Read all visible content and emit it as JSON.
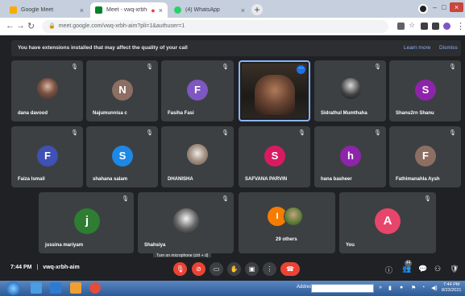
{
  "browser": {
    "tabs": [
      {
        "title": "Google Meet",
        "favicon_color": "#f9ab00",
        "active": false
      },
      {
        "title": "Meet - vwq-xrbh-aim",
        "favicon_color": "#00832d",
        "active": true
      },
      {
        "title": "(4) WhatsApp",
        "favicon_color": "#25d366",
        "active": false
      }
    ],
    "new_tab": "+",
    "url": "meet.google.com/vwq-xrbh-aim?pli=1&authuser=1"
  },
  "notice": {
    "text": "You have extensions installed that may affect the quality of your call",
    "learn_more": "Learn more",
    "dismiss": "Dismiss"
  },
  "participants": {
    "row1": [
      {
        "name": "dana davood",
        "kind": "photo"
      },
      {
        "name": "Najumunnisa c",
        "initial": "N",
        "color": "#8d6e63"
      },
      {
        "name": "Fasiha Fasi",
        "initial": "F",
        "color": "#7e57c2"
      },
      {
        "name": "",
        "kind": "video"
      },
      {
        "name": "Sidrathul Mumthaha",
        "kind": "photo2"
      },
      {
        "name": "Shanu2rn Shanu",
        "initial": "S",
        "color": "#8e24aa"
      }
    ],
    "row2": [
      {
        "name": "Faiza Ismail",
        "initial": "F",
        "color": "#3f51b5"
      },
      {
        "name": "shahana salam",
        "initial": "S",
        "color": "#1e88e5"
      },
      {
        "name": "DHANISHA",
        "kind": "photo3"
      },
      {
        "name": "SAFVANA PARVIN",
        "initial": "S",
        "color": "#d81b60"
      },
      {
        "name": "hana basheer",
        "initial": "h",
        "color": "#8e24aa"
      },
      {
        "name": "Fathimanahla Aysh",
        "initial": "F",
        "color": "#8d6e63"
      }
    ],
    "row3": [
      {
        "name": "jussina mariyam",
        "initial": "j",
        "color": "#2e7d32"
      },
      {
        "name": "Shahsiya",
        "kind": "photo4"
      },
      {
        "name": "29 others",
        "initial": "I",
        "color": "#f57c00"
      },
      {
        "name": "You",
        "initial": "A",
        "color": "#e8456b"
      }
    ]
  },
  "bottom": {
    "time": "7:44 PM",
    "separator": "|",
    "meeting_code": "vwq-xrbh-aim",
    "tooltip": "Turn on microphone (ctrl + d)",
    "people_count": "44"
  },
  "taskbar": {
    "address_label": "Address",
    "clock_time": "7:44 PM",
    "clock_date": "8/23/2021"
  }
}
